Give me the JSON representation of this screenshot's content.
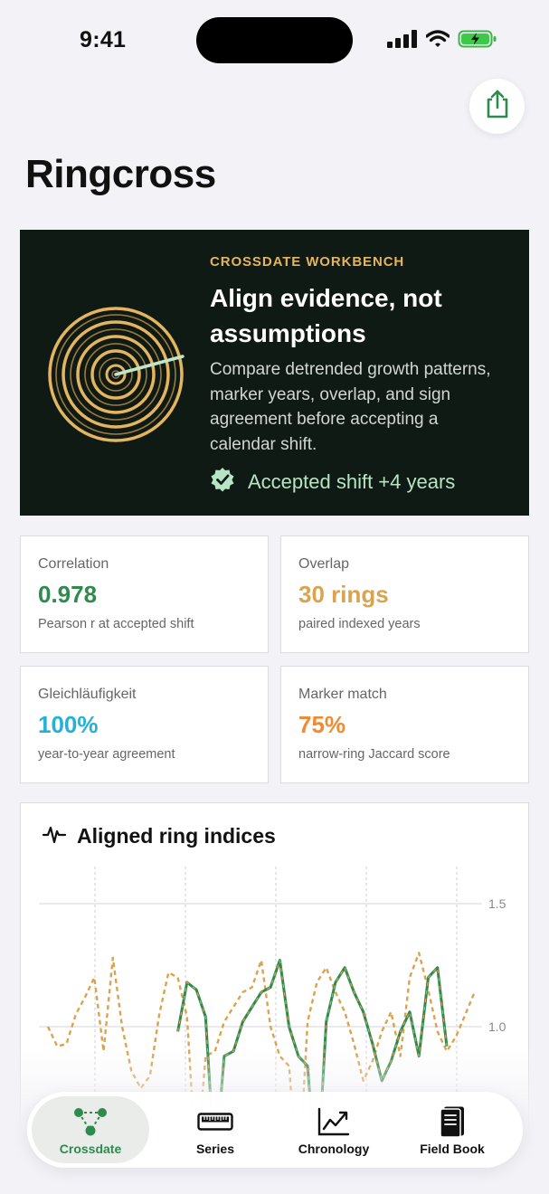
{
  "status_bar": {
    "time": "9:41"
  },
  "header": {
    "title": "Ringcross"
  },
  "hero": {
    "eyebrow": "CROSSDATE WORKBENCH",
    "headline": "Align evidence, not assumptions",
    "body": "Compare detrended growth patterns, marker years, overlap, and sign agreement before accepting a calendar shift.",
    "status": "Accepted shift +4 years",
    "accent_color": "#e4b45f",
    "status_color": "#b6e4c4"
  },
  "metrics": [
    {
      "label": "Correlation",
      "value": "0.978",
      "note": "Pearson r at accepted shift",
      "color": "#2f8a4e"
    },
    {
      "label": "Overlap",
      "value": "30 rings",
      "note": "paired indexed years",
      "color": "#d9a34f"
    },
    {
      "label": "Gleichläufigkeit",
      "value": "100%",
      "note": "year-to-year agreement",
      "color": "#26b1d4"
    },
    {
      "label": "Marker match",
      "value": "75%",
      "note": "narrow-ring Jaccard score",
      "color": "#ef8c33"
    }
  ],
  "chart": {
    "title": "Aligned ring indices",
    "icon": "waveform-icon"
  },
  "chart_data": {
    "type": "line",
    "x": [
      0,
      1,
      2,
      3,
      4,
      5,
      6,
      7,
      8,
      9,
      10,
      11,
      12,
      13,
      14,
      15,
      16,
      17,
      18,
      19,
      20,
      21,
      22,
      23,
      24,
      25,
      26,
      27,
      28,
      29,
      30,
      31,
      32,
      33,
      34,
      35,
      36,
      37,
      38,
      39,
      40,
      41,
      42,
      43,
      44,
      45,
      46,
      47
    ],
    "series": [
      {
        "style": "dashed",
        "color": "#d9a34f",
        "values": [
          1.0,
          0.92,
          0.93,
          1.05,
          1.12,
          1.2,
          0.9,
          1.28,
          1.0,
          0.82,
          0.75,
          0.8,
          1.05,
          1.22,
          1.2,
          1.04,
          0.42,
          0.88,
          0.9,
          1.02,
          1.08,
          1.14,
          1.16,
          1.27,
          1.0,
          0.88,
          0.84,
          0.35,
          1.02,
          1.18,
          1.24,
          1.14,
          1.06,
          0.93,
          0.78,
          0.86,
          0.98,
          1.06,
          0.88,
          1.2,
          1.3,
          1.15,
          0.98,
          0.9,
          0.96,
          1.05,
          1.14
        ]
      },
      {
        "style": "solid",
        "color": "#2f8a4e",
        "start": 14,
        "values": [
          0.98,
          1.18,
          1.15,
          1.04,
          0.42,
          0.88,
          0.9,
          1.02,
          1.08,
          1.14,
          1.16,
          1.27,
          1.0,
          0.88,
          0.84,
          0.35,
          1.02,
          1.18,
          1.24,
          1.14,
          1.06,
          0.93,
          0.78,
          0.86,
          0.98,
          1.06,
          0.88,
          1.2,
          1.24,
          0.92
        ]
      }
    ],
    "yticks": [
      "1.5",
      "1.0"
    ],
    "ylim": [
      0.0,
      1.5
    ],
    "grid": true
  },
  "tabs": [
    {
      "label": "Crossdate",
      "icon": "crossdate-network-icon",
      "active": true
    },
    {
      "label": "Series",
      "icon": "ruler-icon",
      "active": false
    },
    {
      "label": "Chronology",
      "icon": "trend-chart-icon",
      "active": false
    },
    {
      "label": "Field Book",
      "icon": "notebook-icon",
      "active": false
    }
  ]
}
